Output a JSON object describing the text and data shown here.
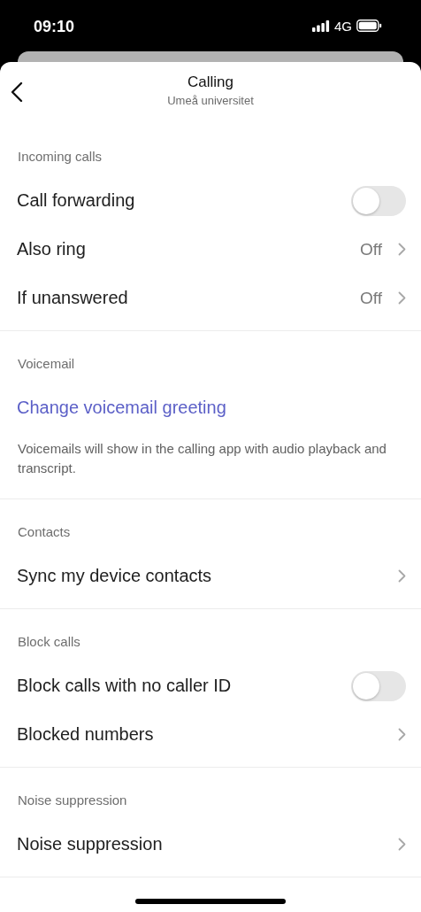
{
  "status_bar": {
    "time": "09:10",
    "network": "4G"
  },
  "header": {
    "title": "Calling",
    "subtitle": "Umeå universitet"
  },
  "sections": [
    {
      "title": "Incoming calls",
      "items": [
        {
          "kind": "toggle",
          "label": "Call forwarding",
          "on": false
        },
        {
          "kind": "value",
          "label": "Also ring",
          "value": "Off"
        },
        {
          "kind": "value",
          "label": "If unanswered",
          "value": "Off"
        }
      ]
    },
    {
      "title": "Voicemail",
      "items": [
        {
          "kind": "link",
          "label": "Change voicemail greeting"
        },
        {
          "kind": "note",
          "text": "Voicemails will show in the calling app with audio playback and transcript."
        }
      ]
    },
    {
      "title": "Contacts",
      "items": [
        {
          "kind": "chevron",
          "label": "Sync my device contacts"
        }
      ]
    },
    {
      "title": "Block calls",
      "items": [
        {
          "kind": "toggle",
          "label": "Block calls with no caller ID",
          "on": false
        },
        {
          "kind": "chevron",
          "label": "Blocked numbers"
        }
      ]
    },
    {
      "title": "Noise suppression",
      "items": [
        {
          "kind": "chevron",
          "label": "Noise suppression"
        }
      ]
    }
  ]
}
